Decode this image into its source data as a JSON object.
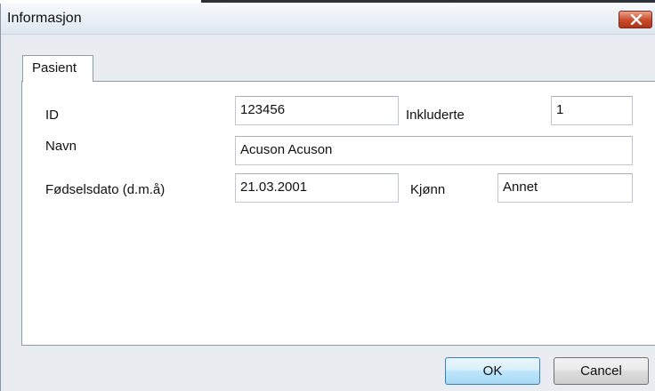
{
  "window": {
    "title": "Informasjon",
    "tab_label": "Pasient"
  },
  "form": {
    "id_label": "ID",
    "id_value": "123456",
    "included_label": "Inkluderte",
    "included_value": "1",
    "name_label": "Navn",
    "name_value": "Acuson Acuson",
    "dob_label": "Fødselsdato (d.m.å)",
    "dob_value": "21.03.2001",
    "gender_label": "Kjønn",
    "gender_value": "Annet"
  },
  "buttons": {
    "ok_label": "OK",
    "cancel_label": "Cancel"
  },
  "colors": {
    "close_button": "#c8482a",
    "ok_border": "#3c7fb1"
  },
  "icons": {
    "close": "close-icon"
  }
}
